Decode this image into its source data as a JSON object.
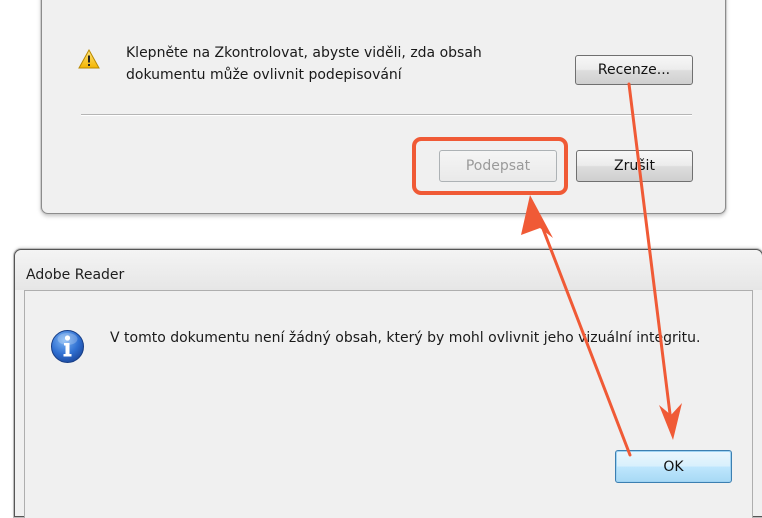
{
  "top_dialog": {
    "message": "Klepněte na Zkontrolovat, abyste viděli, zda obsah dokumentu může ovlivnit podepisování",
    "review_button": "Recenze...",
    "sign_button": "Podepsat",
    "cancel_button": "Zrušit",
    "icon": "warning-icon"
  },
  "bottom_dialog": {
    "title": "Adobe Reader",
    "message": "V tomto dokumentu není žádný obsah, který by mohl ovlivnit jeho vizuální integritu.",
    "ok_button": "OK",
    "icon": "info-icon"
  },
  "annotation": {
    "color": "#f05a36"
  }
}
